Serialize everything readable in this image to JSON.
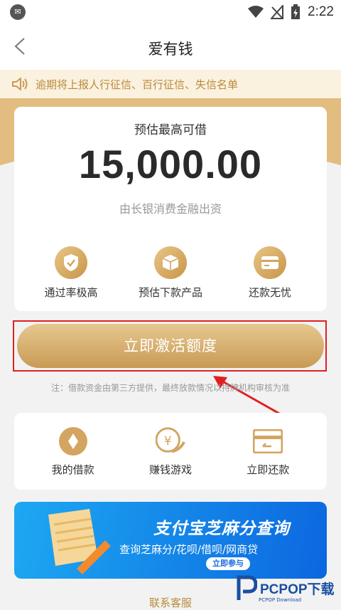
{
  "status_bar": {
    "time": "2:22",
    "app_icon": "app-notification-icon"
  },
  "nav": {
    "title": "爱有钱",
    "back_icon": "back-chevron-icon"
  },
  "notice": {
    "text": "逾期将上报人行征信、百行征信、失信名单",
    "icon": "speaker-icon"
  },
  "card": {
    "subtitle": "预估最高可借",
    "amount": "15,000.00",
    "lender": "由长银消费金融出资",
    "features": [
      {
        "label": "通过率极高",
        "icon": "shield-check-icon"
      },
      {
        "label": "预估下款产品",
        "icon": "box-icon"
      },
      {
        "label": "还款无忧",
        "icon": "card-icon"
      }
    ]
  },
  "cta": {
    "label": "立即激活额度"
  },
  "note": "注：借款资金由第三方提供，最终放款情况以持牌机构审核为准",
  "menu": {
    "items": [
      {
        "label": "我的借款",
        "icon": "diamond-coin-icon"
      },
      {
        "label": "赚钱游戏",
        "icon": "yen-coin-icon"
      },
      {
        "label": "立即还款",
        "icon": "card-return-icon"
      }
    ]
  },
  "banner": {
    "title": "支付宝芝麻分查询",
    "subtitle": "查询芝麻分/花呗/借呗/网商贷",
    "button": "立即参与"
  },
  "contact": "联系客服",
  "watermark": {
    "text": "PCPOP下载",
    "sub": "PCPOP Download"
  },
  "colors": {
    "gold": "#c99a55",
    "gold_light": "#e6c88f",
    "notice_bg": "#fbf1df",
    "highlight": "#e02020",
    "banner_blue": "#0c67e0"
  }
}
